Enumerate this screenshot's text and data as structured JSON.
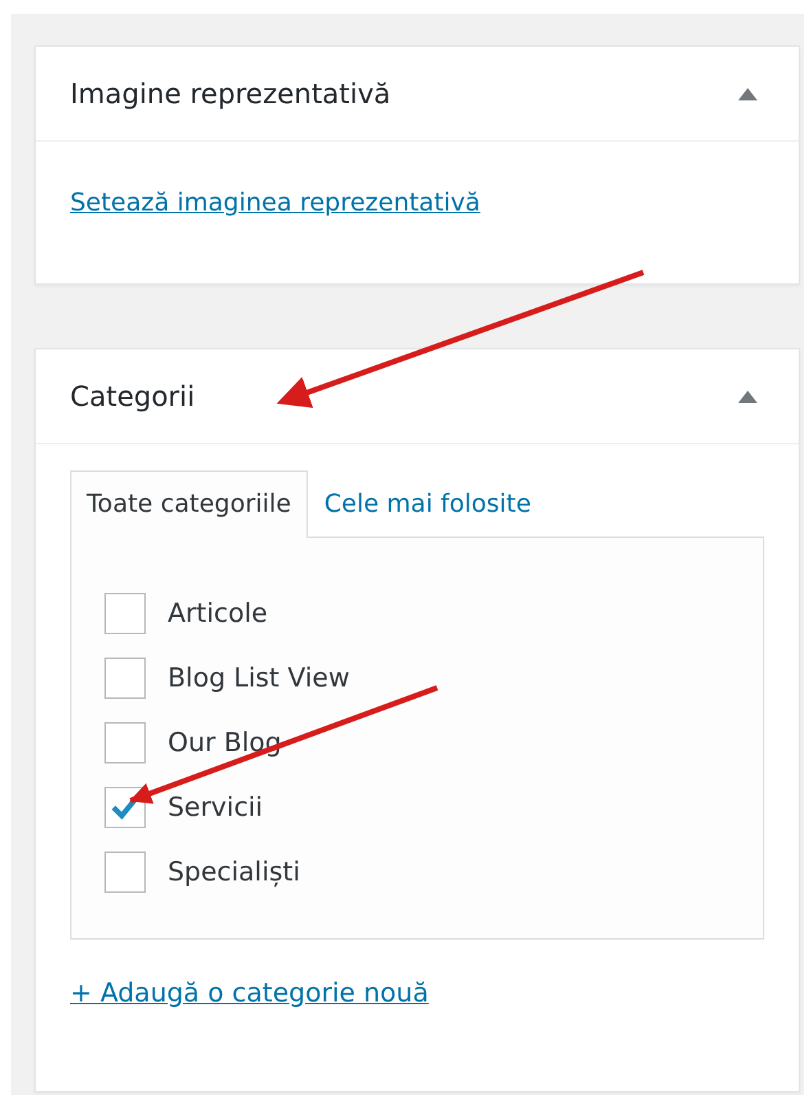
{
  "panels": [
    {
      "kind": "image",
      "title": "Imagine reprezentativă",
      "expanded": true,
      "link": "Setează imaginea reprezentativă"
    },
    {
      "kind": "categories",
      "title": "Categorii",
      "expanded": true,
      "tabs": [
        {
          "label": "Toate categoriile",
          "selected": true
        },
        {
          "label": "Cele mai folosite",
          "selected": false
        }
      ],
      "categories": [
        {
          "label": "Articole",
          "checked": false
        },
        {
          "label": "Blog List View",
          "checked": false
        },
        {
          "label": "Our Blog",
          "checked": false
        },
        {
          "label": "Servicii",
          "checked": true
        },
        {
          "label": "Specialiști",
          "checked": false
        }
      ],
      "link": "+ Adaugă o categorie nouă"
    }
  ]
}
